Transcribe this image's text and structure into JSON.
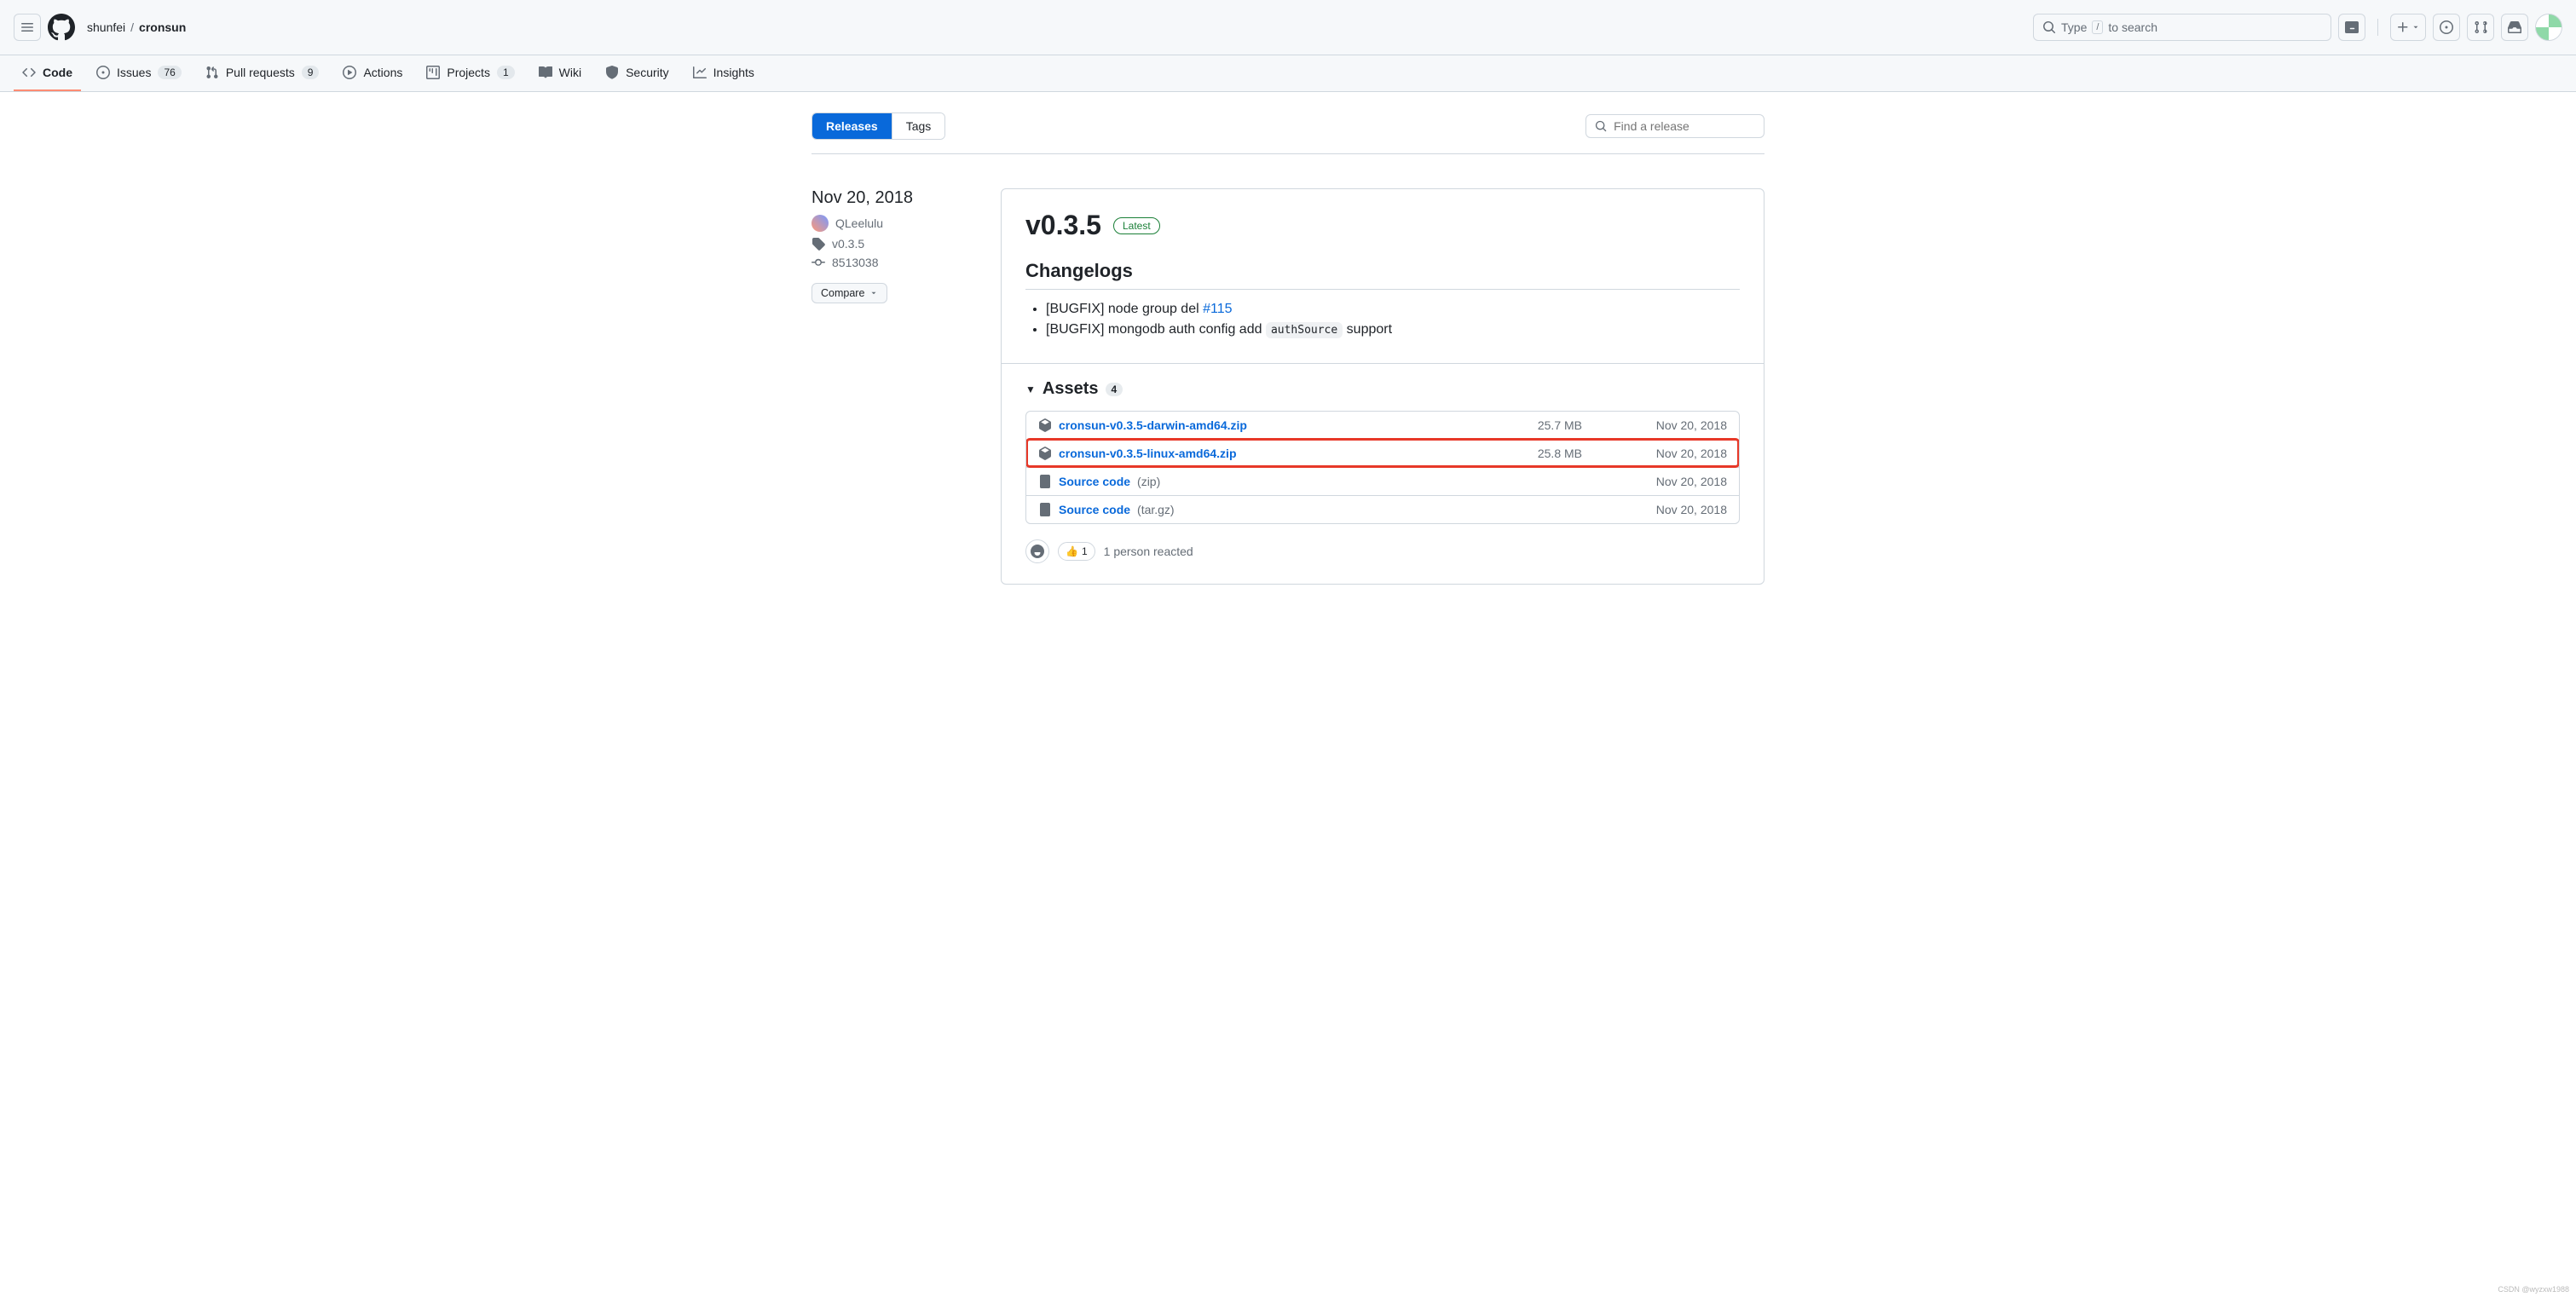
{
  "header": {
    "owner": "shunfei",
    "repo": "cronsun",
    "search_prefix": "Type",
    "search_suffix": "to search"
  },
  "nav": {
    "code": "Code",
    "issues": "Issues",
    "issues_count": "76",
    "pulls": "Pull requests",
    "pulls_count": "9",
    "actions": "Actions",
    "projects": "Projects",
    "projects_count": "1",
    "wiki": "Wiki",
    "security": "Security",
    "insights": "Insights"
  },
  "tabs": {
    "releases": "Releases",
    "tags": "Tags"
  },
  "search": {
    "placeholder": "Find a release"
  },
  "sidebar": {
    "date": "Nov 20, 2018",
    "author": "QLeelulu",
    "tag": "v0.3.5",
    "commit": "8513038",
    "compare": "Compare"
  },
  "release": {
    "title": "v0.3.5",
    "latest": "Latest",
    "changelogs_h": "Changelogs",
    "items": [
      {
        "prefix": "[BUGFIX] node group del ",
        "link": "#115",
        "suffix": ""
      },
      {
        "prefix": "[BUGFIX] mongodb auth config add ",
        "code": "authSource",
        "suffix": " support"
      }
    ]
  },
  "assets": {
    "label": "Assets",
    "count": "4",
    "rows": [
      {
        "name": "cronsun-v0.3.5-darwin-amd64.zip",
        "size": "25.7 MB",
        "date": "Nov 20, 2018",
        "icon": "pkg"
      },
      {
        "name": "cronsun-v0.3.5-linux-amd64.zip",
        "size": "25.8 MB",
        "date": "Nov 20, 2018",
        "icon": "pkg",
        "highlight": true
      },
      {
        "name": "Source code",
        "suffix": " (zip)",
        "size": "",
        "date": "Nov 20, 2018",
        "icon": "zip"
      },
      {
        "name": "Source code",
        "suffix": " (tar.gz)",
        "size": "",
        "date": "Nov 20, 2018",
        "icon": "zip"
      }
    ]
  },
  "reactions": {
    "emoji": "👍",
    "count": "1",
    "text": "1 person reacted"
  },
  "watermark": "CSDN @wyzxw1988"
}
